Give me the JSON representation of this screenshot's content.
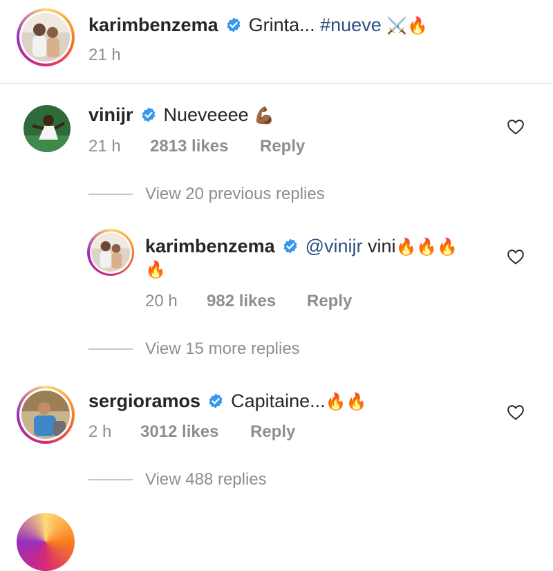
{
  "post": {
    "username": "karimbenzema",
    "caption_text": "Grinta... ",
    "hashtag": "#nueve",
    "caption_emojis": "⚔️🔥",
    "time": "21 h"
  },
  "comments": [
    {
      "username": "vinijr",
      "text": "Nueveeee",
      "emoji": "💪🏾",
      "time": "21 h",
      "likes": "2813 likes",
      "reply_label": "Reply",
      "view_replies": "View 20 previous replies"
    },
    {
      "username": "karimbenzema",
      "mention": "@vinijr",
      "text": " vini",
      "emoji_line1": "🔥🔥🔥",
      "emoji_line2": "🔥",
      "time": "20 h",
      "likes": "982 likes",
      "reply_label": "Reply",
      "view_replies": "View 15 more replies"
    },
    {
      "username": "sergioramos",
      "text": "Capitaine...",
      "emoji": "🔥🔥",
      "time": "2 h",
      "likes": "3012 likes",
      "reply_label": "Reply",
      "view_replies": "View 488 replies"
    }
  ],
  "colors": {
    "text": "#262626",
    "muted": "#8e8e8e",
    "hashtag": "#2d4f83",
    "verified": "#3897f0"
  },
  "icons": {
    "verified": "verified-badge-icon",
    "like": "heart-outline-icon"
  }
}
